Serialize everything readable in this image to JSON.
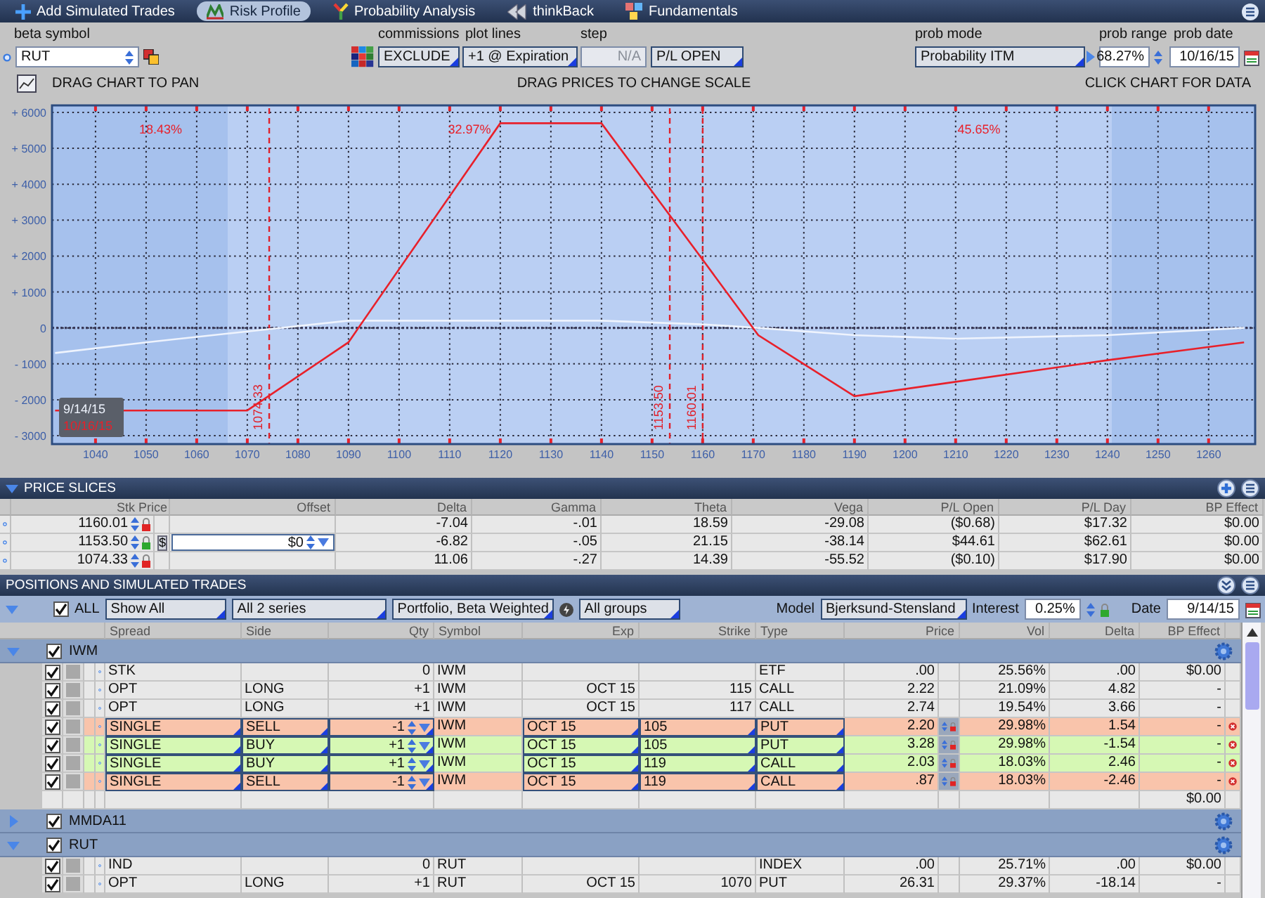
{
  "tabs": [
    {
      "label": "Add Simulated Trades",
      "selected": false
    },
    {
      "label": "Risk Profile",
      "selected": true
    },
    {
      "label": "Probability Analysis",
      "selected": false
    },
    {
      "label": "thinkBack",
      "selected": false
    },
    {
      "label": "Fundamentals",
      "selected": false
    }
  ],
  "settings": {
    "beta_symbol": {
      "label": "beta symbol",
      "value": "RUT"
    },
    "commissions": {
      "label": "commissions",
      "value": "EXCLUDE"
    },
    "plot_lines": {
      "label": "plot lines",
      "value": "+1 @ Expiration"
    },
    "step": {
      "label": "step",
      "placeholder": "N/A",
      "mode": "P/L OPEN"
    },
    "prob_mode": {
      "label": "prob mode",
      "value": "Probability ITM"
    },
    "prob_range": {
      "label": "prob range",
      "value": "68.27%"
    },
    "prob_date": {
      "label": "prob date",
      "value": "10/16/15"
    }
  },
  "chart_hints": [
    "DRAG CHART TO PAN",
    "DRAG PRICES TO CHANGE SCALE",
    "CLICK CHART FOR DATA"
  ],
  "chart_data": {
    "type": "line",
    "x": [
      1032,
      1050,
      1070,
      1090,
      1120,
      1140,
      1160,
      1171,
      1190,
      1210,
      1240,
      1267
    ],
    "series": [
      {
        "name": "9/14/15",
        "color": "#eef3fd",
        "values": [
          -700,
          -400,
          -100,
          200,
          200,
          200,
          100,
          0,
          -200,
          -300,
          -200,
          0
        ]
      },
      {
        "name": "10/16/15",
        "color": "#e8202a",
        "values": [
          -2300,
          -2300,
          -2300,
          -400,
          5700,
          5700,
          1900,
          -200,
          -1900,
          -1500,
          -900,
          -400
        ]
      }
    ],
    "grid": true,
    "xlim": [
      1031.4,
      1269.2
    ],
    "ylim": [
      -3234,
      6195
    ],
    "xticks": [
      1040,
      1050,
      1060,
      1070,
      1080,
      1090,
      1100,
      1110,
      1120,
      1130,
      1140,
      1150,
      1160,
      1170,
      1180,
      1190,
      1200,
      1210,
      1220,
      1230,
      1240,
      1250,
      1260
    ],
    "yticks": [
      {
        "value": 6000,
        "label": "+ 6000"
      },
      {
        "value": 5000,
        "label": "+ 5000"
      },
      {
        "value": 4000,
        "label": "+ 4000"
      },
      {
        "value": 3000,
        "label": "+ 3000"
      },
      {
        "value": 2000,
        "label": "+ 2000"
      },
      {
        "value": 1000,
        "label": "+ 1000"
      },
      {
        "value": 0,
        "label": "0"
      },
      {
        "value": -1000,
        "label": "- 1000"
      },
      {
        "value": -2000,
        "label": "- 2000"
      },
      {
        "value": -3000,
        "label": "- 3000"
      }
    ],
    "ref_lines": [
      {
        "axis": "y",
        "value": 0
      },
      {
        "axis": "x",
        "value": 1074.33,
        "label": "1074.33"
      },
      {
        "axis": "x",
        "value": 1153.5,
        "label": "1153.50"
      },
      {
        "axis": "x",
        "value": 1160.01,
        "label": "1160.01"
      }
    ],
    "annotations": [
      "18.43%",
      "32.97%",
      "45.65%"
    ]
  },
  "price_slices": {
    "title": "PRICE SLICES",
    "columns": [
      "Stk Price",
      "Offset",
      "Delta",
      "Gamma",
      "Theta",
      "Vega",
      "P/L Open",
      "P/L Day",
      "BP Effect"
    ],
    "rows": [
      {
        "price": "1160.01",
        "locked": true,
        "values": [
          "-7.04",
          "-.01",
          "18.59",
          "-29.08",
          "($0.68)",
          "$17.32",
          "$0.00"
        ]
      },
      {
        "price": "1153.50",
        "locked": false,
        "currency": "$",
        "offset": "$0",
        "values": [
          "-6.82",
          "-.05",
          "21.15",
          "-38.14",
          "$44.61",
          "$62.61",
          "$0.00"
        ]
      },
      {
        "price": "1074.33",
        "locked": true,
        "values": [
          "11.06",
          "-.27",
          "14.39",
          "-55.52",
          "($0.10)",
          "$17.90",
          "$0.00"
        ]
      }
    ]
  },
  "positions": {
    "title": "POSITIONS AND SIMULATED TRADES",
    "all_checked": true,
    "all_label": "ALL",
    "filters": [
      "Show All",
      "All 2 series",
      "Portfolio, Beta Weighted",
      "All groups"
    ],
    "model_label": "Model",
    "model": "Bjerksund-Stensland",
    "interest_label": "Interest",
    "interest": "0.25%",
    "date_label": "Date",
    "date": "9/14/15",
    "columns": [
      "Spread",
      "Side",
      "Qty",
      "Symbol",
      "Exp",
      "Strike",
      "Type",
      "Price",
      "Vol",
      "Delta",
      "BP Effect"
    ],
    "groups": [
      {
        "name": "IWM",
        "checked": true,
        "expanded": true,
        "total": "$0.00",
        "rows": [
          {
            "kind": "held",
            "checked": true,
            "spread": "STK",
            "qty": "0",
            "symbol": "IWM",
            "type": "ETF",
            "price": ".00",
            "vol": "25.56%",
            "delta": ".00",
            "bp": "$0.00"
          },
          {
            "kind": "held",
            "checked": true,
            "spread": "OPT",
            "side": "LONG",
            "qty": "+1",
            "symbol": "IWM",
            "exp": "OCT 15",
            "strike": "115",
            "type": "CALL",
            "price": "2.22",
            "vol": "21.09%",
            "delta": "4.82",
            "bp": "-"
          },
          {
            "kind": "held",
            "checked": true,
            "spread": "OPT",
            "side": "LONG",
            "qty": "+1",
            "symbol": "IWM",
            "exp": "OCT 15",
            "strike": "117",
            "type": "CALL",
            "price": "2.74",
            "vol": "19.54%",
            "delta": "3.66",
            "bp": "-"
          },
          {
            "kind": "sell",
            "checked": true,
            "spread": "SINGLE",
            "side": "SELL",
            "qty": "-1",
            "symbol": "IWM",
            "exp": "OCT 15",
            "strike": "105",
            "type": "PUT",
            "price": "2.20",
            "vol": "29.98%",
            "delta": "1.54",
            "bp": "-"
          },
          {
            "kind": "buy",
            "checked": true,
            "spread": "SINGLE",
            "side": "BUY",
            "qty": "+1",
            "symbol": "IWM",
            "exp": "OCT 15",
            "strike": "105",
            "type": "PUT",
            "price": "3.28",
            "vol": "29.98%",
            "delta": "-1.54",
            "bp": "-"
          },
          {
            "kind": "buy",
            "checked": true,
            "spread": "SINGLE",
            "side": "BUY",
            "qty": "+1",
            "symbol": "IWM",
            "exp": "OCT 15",
            "strike": "119",
            "type": "CALL",
            "price": "2.03",
            "vol": "18.03%",
            "delta": "2.46",
            "bp": "-"
          },
          {
            "kind": "sell",
            "checked": true,
            "spread": "SINGLE",
            "side": "SELL",
            "qty": "-1",
            "symbol": "IWM",
            "exp": "OCT 15",
            "strike": "119",
            "type": "CALL",
            "price": ".87",
            "vol": "18.03%",
            "delta": "-2.46",
            "bp": "-"
          }
        ]
      },
      {
        "name": "MMDA11",
        "checked": true,
        "expanded": false
      },
      {
        "name": "RUT",
        "checked": true,
        "expanded": true,
        "rows": [
          {
            "kind": "held",
            "checked": true,
            "spread": "IND",
            "qty": "0",
            "symbol": "RUT",
            "type": "INDEX",
            "price": ".00",
            "vol": "25.71%",
            "delta": ".00",
            "bp": "$0.00"
          },
          {
            "kind": "held",
            "checked": true,
            "spread": "OPT",
            "side": "LONG",
            "qty": "+1",
            "symbol": "RUT",
            "exp": "OCT 15",
            "strike": "1070",
            "type": "PUT",
            "price": "26.31",
            "vol": "29.37%",
            "delta": "-18.14",
            "bp": "-"
          }
        ]
      }
    ]
  }
}
